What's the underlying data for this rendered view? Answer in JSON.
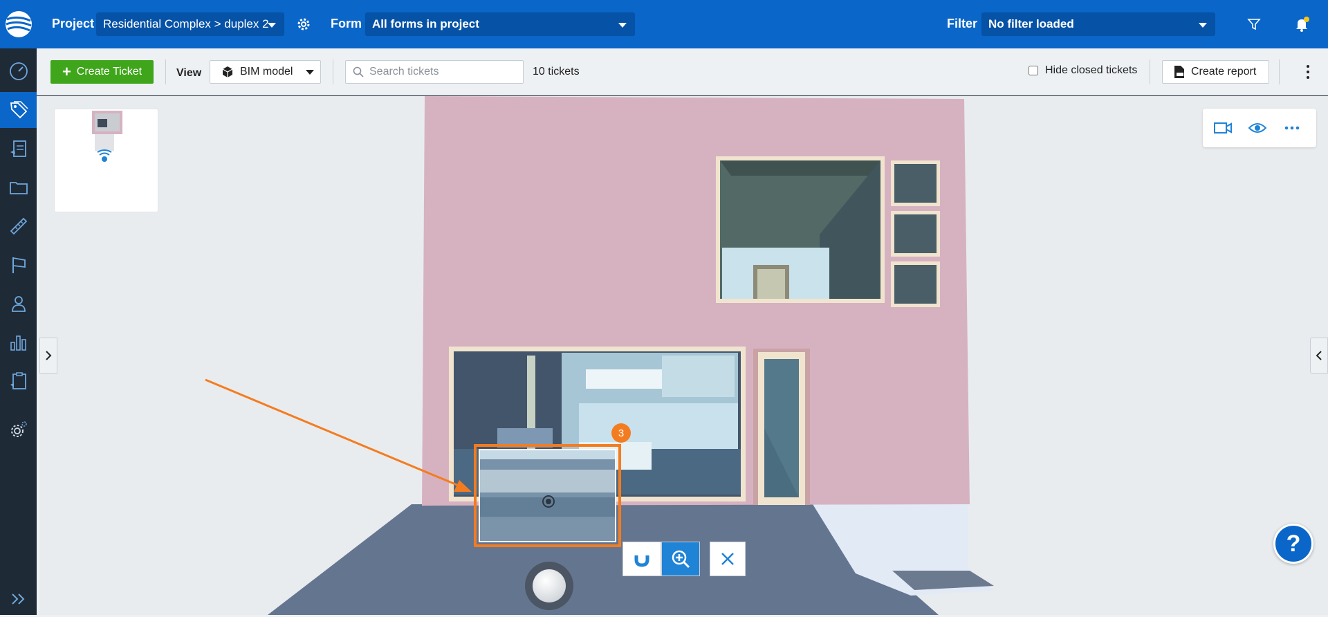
{
  "topbar": {
    "project_label": "Project",
    "project_value": "Residential Complex > duplex 2",
    "form_label": "Form",
    "form_value": "All forms in project",
    "filter_label": "Filter",
    "filter_value": "No filter loaded"
  },
  "toolbar": {
    "create_ticket_label": "Create Ticket",
    "view_label": "View",
    "view_value": "BIM model",
    "search_placeholder": "Search tickets",
    "tickets_count": "10 tickets",
    "hide_closed_label": "Hide closed tickets",
    "create_report_label": "Create report"
  },
  "sidebar": {
    "items": [
      {
        "icon": "dashboard-gauge-icon"
      },
      {
        "icon": "tickets-tag-icon",
        "active": true
      },
      {
        "icon": "forms-document-icon"
      },
      {
        "icon": "folder-icon"
      },
      {
        "icon": "ruler-measure-icon"
      },
      {
        "icon": "flag-icon"
      },
      {
        "icon": "user-person-icon"
      },
      {
        "icon": "analytics-bar-chart-icon"
      },
      {
        "icon": "clipboard-checklist-icon"
      },
      {
        "icon": "settings-gear-icon"
      },
      {
        "icon": "expand-double-chevron-icon"
      }
    ]
  },
  "viewer": {
    "pin_number": "3",
    "help_label": "?"
  },
  "colors": {
    "brand_blue": "#0a66c8",
    "create_green": "#3fa51b",
    "sidebar_dark": "#1f2a37",
    "wall_pink": "#d6b2c1",
    "selection_orange": "#f47c20"
  }
}
